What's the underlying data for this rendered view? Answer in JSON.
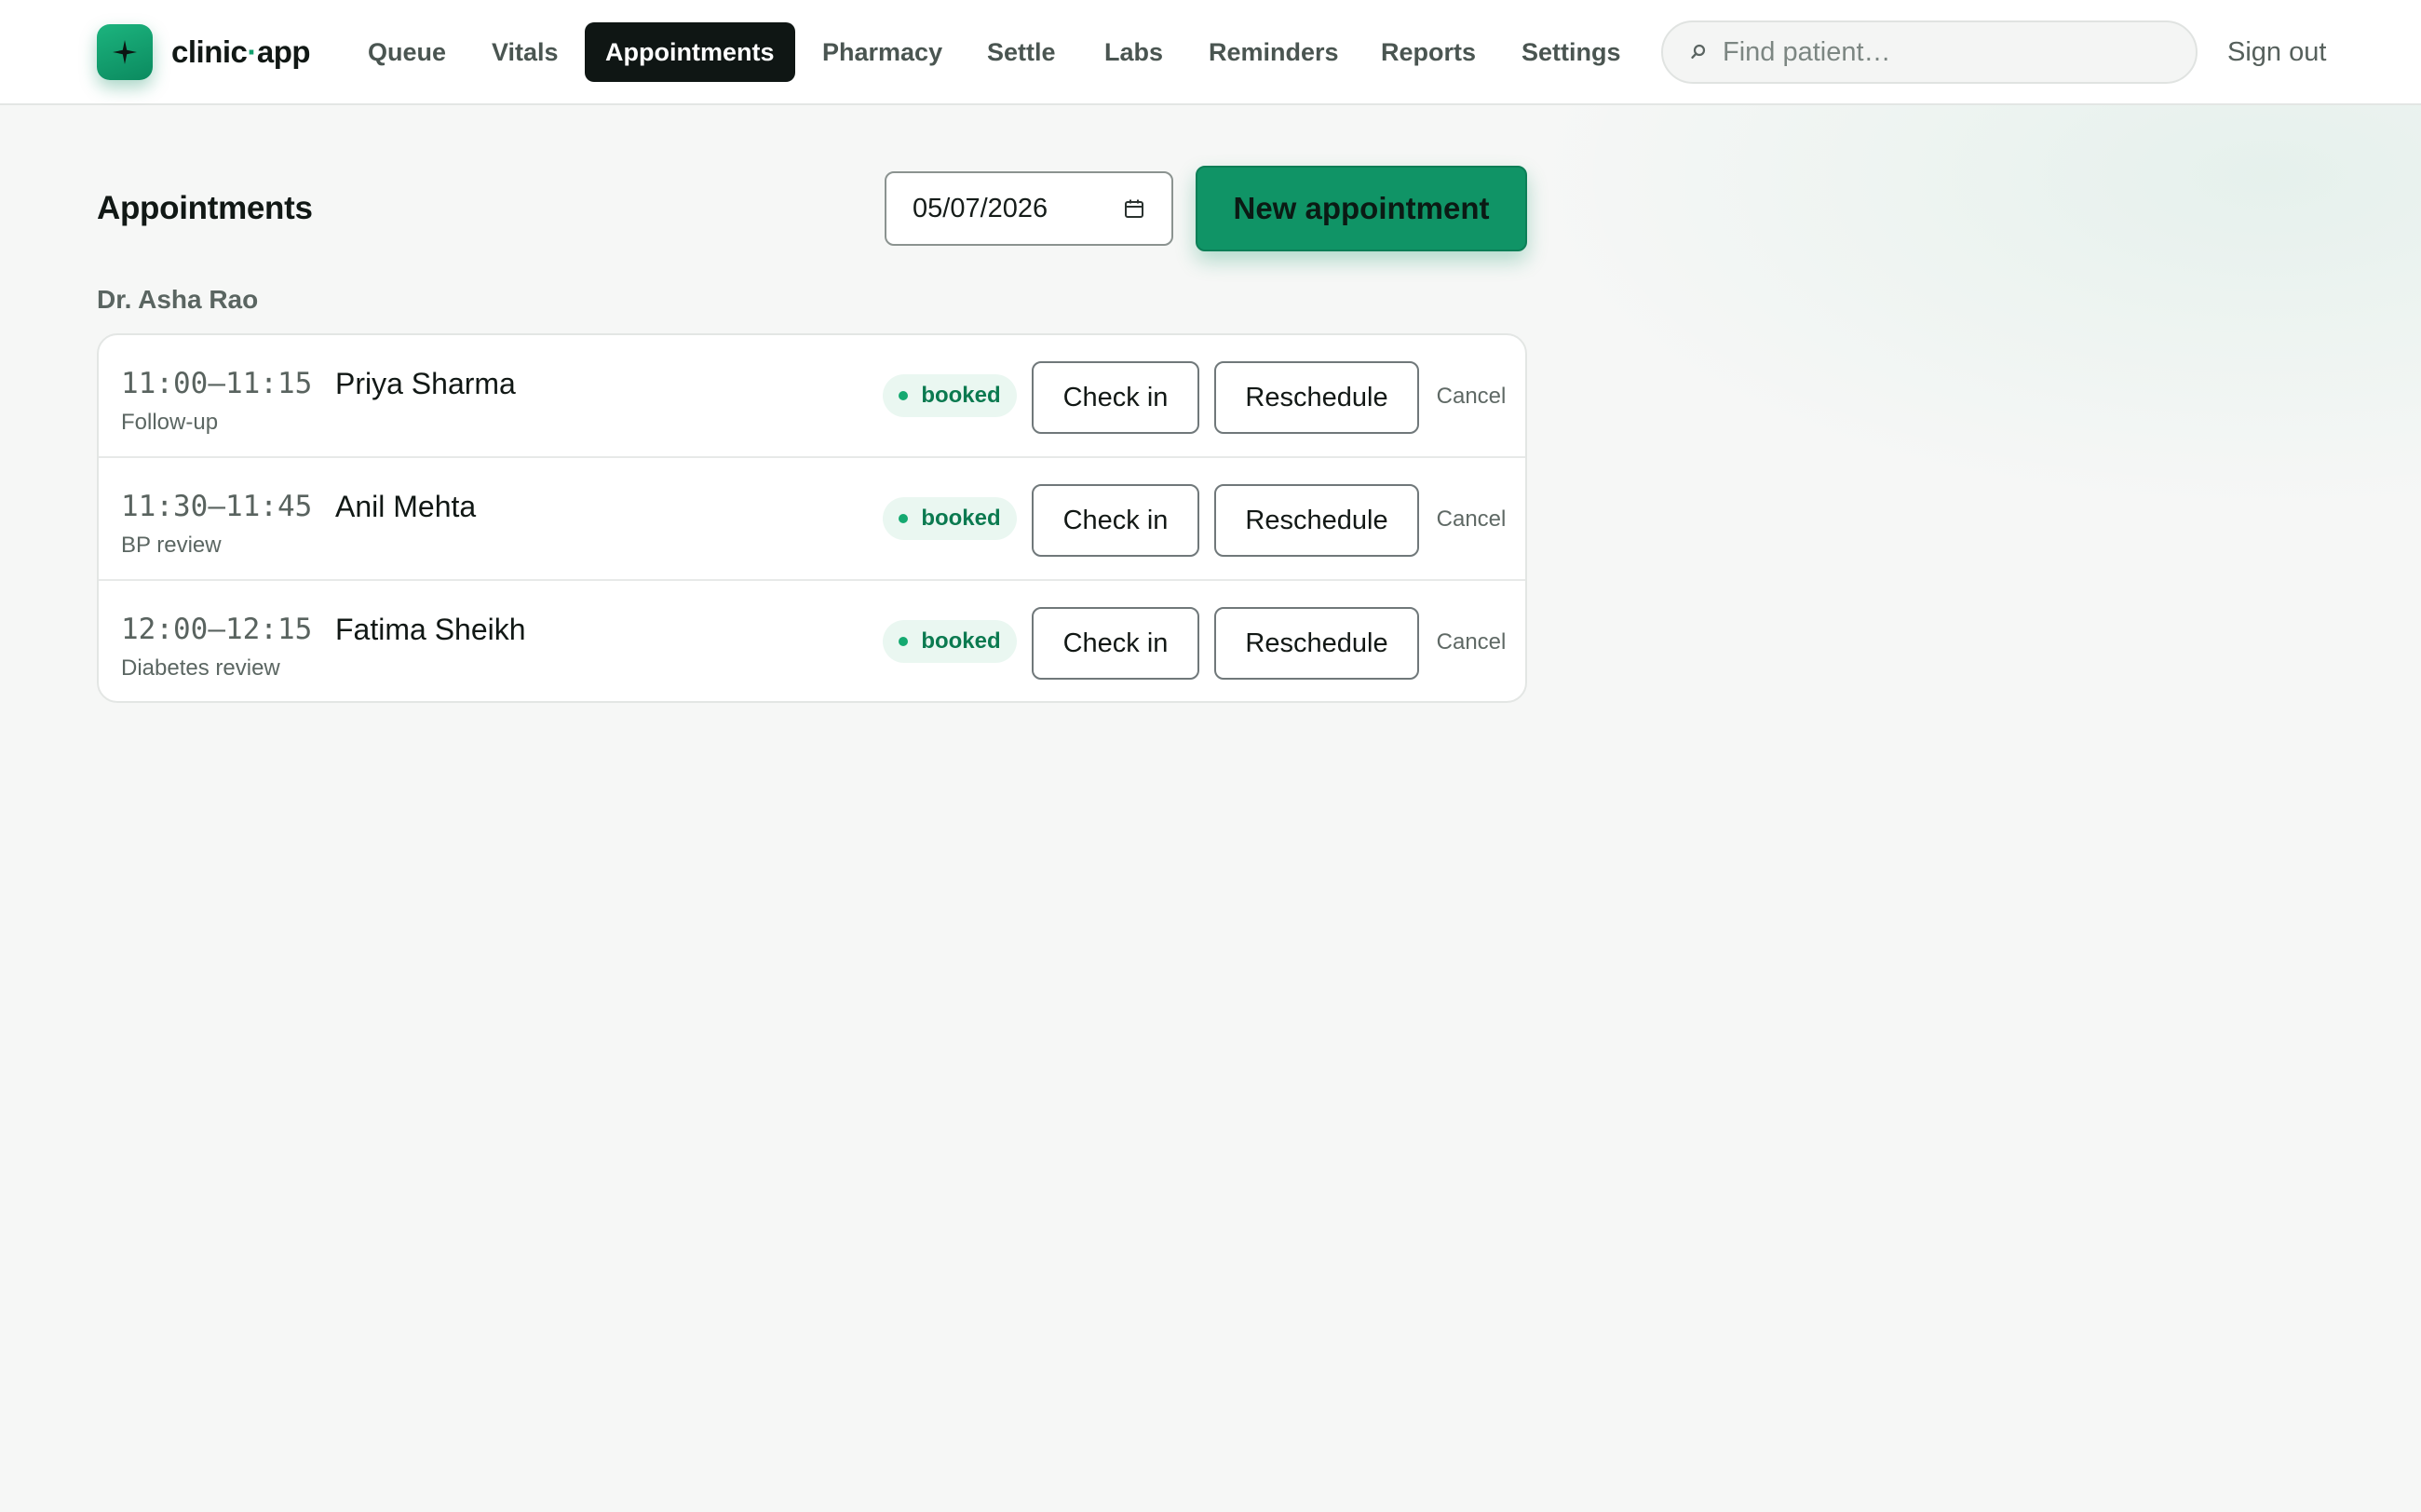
{
  "brand": {
    "name_part1": "clinic",
    "name_sep": "·",
    "name_part2": "app",
    "accent": "#12a06e"
  },
  "nav": {
    "items": [
      {
        "label": "Queue"
      },
      {
        "label": "Vitals"
      },
      {
        "label": "Appointments",
        "active": true
      },
      {
        "label": "Pharmacy"
      },
      {
        "label": "Settle"
      },
      {
        "label": "Labs"
      },
      {
        "label": "Reminders"
      },
      {
        "label": "Reports"
      },
      {
        "label": "Settings"
      }
    ]
  },
  "search": {
    "placeholder": "Find patient…",
    "value": "",
    "icon": "search-icon"
  },
  "header": {
    "signout_label": "Sign out"
  },
  "main": {
    "title": "Appointments",
    "date_value": "05/07/2026",
    "new_button_label": "New appointment",
    "doctor": "Dr. Asha Rao",
    "appointments": [
      {
        "time": "11:00–11:15",
        "patient": "Priya Sharma",
        "reason": "Follow-up",
        "status": "booked"
      },
      {
        "time": "11:30–11:45",
        "patient": "Anil Mehta",
        "reason": "BP review",
        "status": "booked"
      },
      {
        "time": "12:00–12:15",
        "patient": "Fatima Sheikh",
        "reason": "Diabetes review",
        "status": "booked"
      }
    ],
    "actions": {
      "checkin_label": "Check in",
      "reschedule_label": "Reschedule",
      "cancel_label": "Cancel"
    }
  },
  "colors": {
    "primary": "#109466",
    "status_booked": "#0b7a50",
    "active_nav_bg": "#0f1614"
  }
}
